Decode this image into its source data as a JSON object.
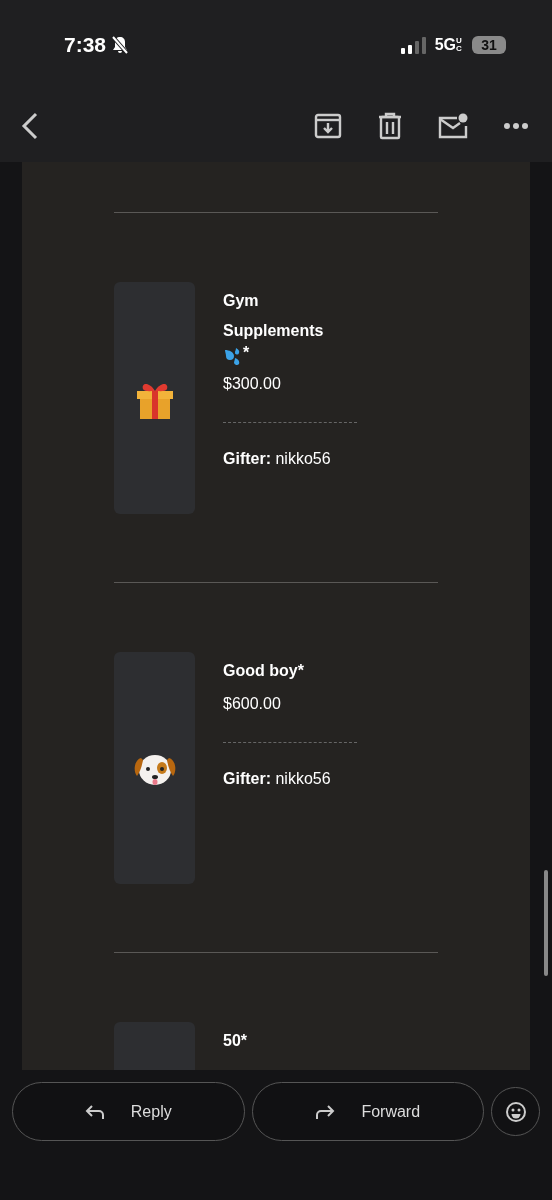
{
  "status_bar": {
    "time": "7:38",
    "network": "5G",
    "network_suffix": "UC",
    "battery": "31"
  },
  "toolbar": {
    "actions": [
      {
        "kind": "archive"
      },
      {
        "kind": "delete"
      },
      {
        "kind": "unread"
      },
      {
        "kind": "more"
      }
    ]
  },
  "items": [
    {
      "kind": "gift",
      "title": "Gym Supplements",
      "suffix": {
        "kind": "droplets",
        "text": "*"
      },
      "price": "$300.00",
      "gifter_label": "Gifter:",
      "gifter": "nikko56"
    },
    {
      "kind": "dog",
      "title": "Good boy*",
      "price": "$600.00",
      "gifter_label": "Gifter:",
      "gifter": "nikko56"
    },
    {
      "title": "50*"
    }
  ],
  "bottom_bar": {
    "buttons": [
      {
        "kind": "reply",
        "label": "Reply"
      },
      {
        "kind": "forward",
        "label": "Forward"
      }
    ]
  }
}
